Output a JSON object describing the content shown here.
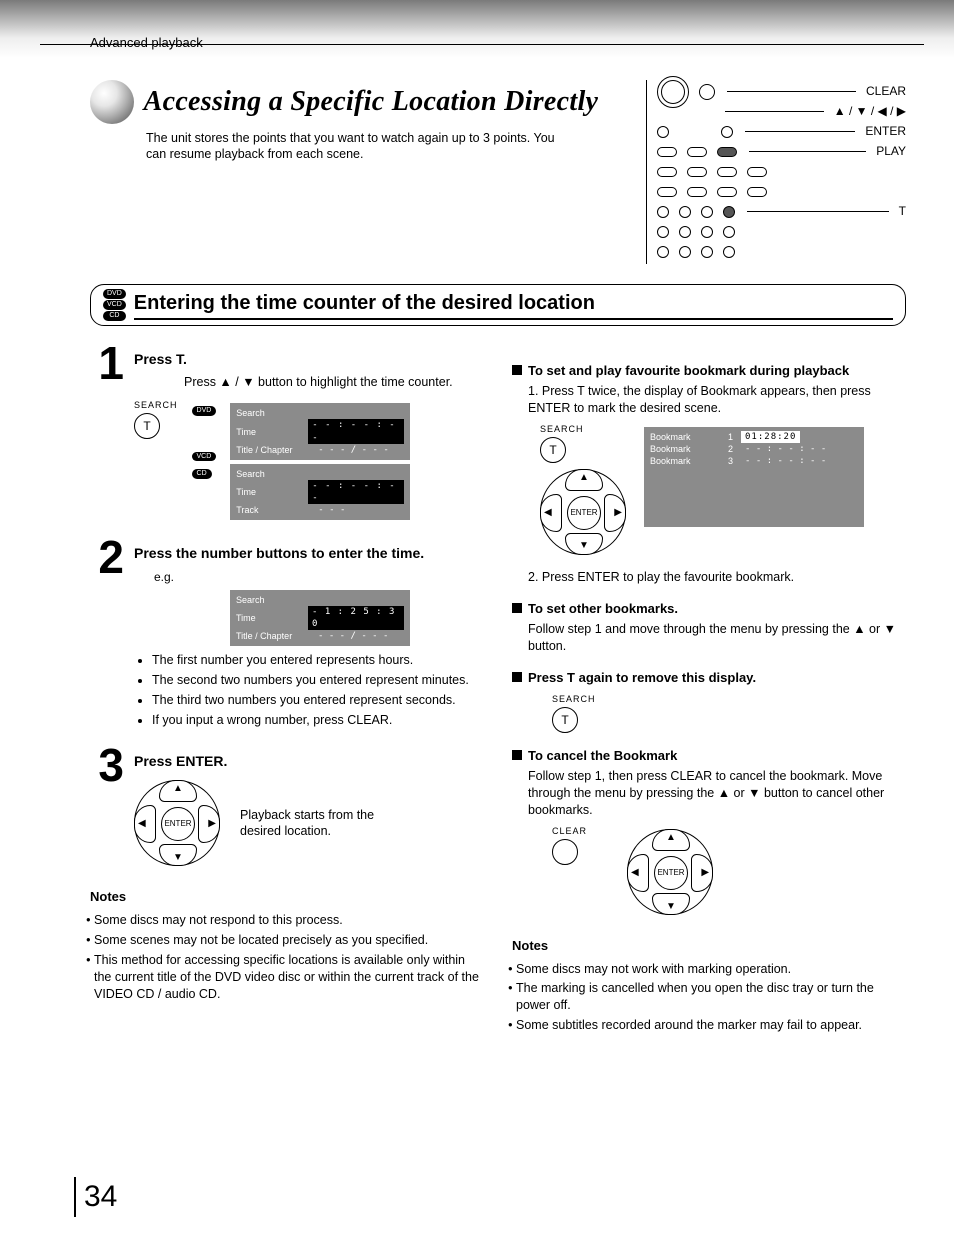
{
  "breadcrumb": "Advanced playback",
  "hero": {
    "title": "Accessing a Specific Location Directly",
    "sub": "The unit stores the points that you want to watch again up to 3 points. You can resume playback from each scene."
  },
  "remote_labels": {
    "clear": "CLEAR",
    "arrows": "▲ / ▼ / ◀ / ▶",
    "enter": "ENTER",
    "play": "PLAY",
    "t": "T"
  },
  "section": {
    "tags": [
      "DVD",
      "VCD",
      "CD"
    ],
    "title": "Entering the time counter of the desired location"
  },
  "left": {
    "step1": {
      "num": "1",
      "h": "Press T.",
      "p": "Press ▲ / ▼ button to highlight the time counter.",
      "search_label": "SEARCH",
      "t_label": "T",
      "dvd_tag": "DVD",
      "vcdcd_tags": [
        "VCD",
        "CD"
      ],
      "osd1": {
        "r1l": "Search",
        "r1v": "",
        "r2l": "Time",
        "r2v": "- - : - - : - -",
        "r3l": "Title / Chapter",
        "r3v": "- - - / - - -"
      },
      "osd2": {
        "r1l": "Search",
        "r1v": "",
        "r2l": "Time",
        "r2v": "- - : - - : - -",
        "r3l": "Track",
        "r3v": "- - -"
      }
    },
    "step2": {
      "num": "2",
      "h": "Press the number buttons to enter the time.",
      "eg": "e.g.",
      "osd": {
        "r1l": "Search",
        "r1v": "",
        "r2l": "Time",
        "r2v": "- 1 : 2 5 : 3 0",
        "r3l": "Title / Chapter",
        "r3v": "- - - / - - -"
      },
      "bullets": [
        "The first number you entered represents hours.",
        "The second two numbers you entered represent minutes.",
        "The third two numbers you entered represent seconds.",
        "If you input a wrong number, press CLEAR."
      ]
    },
    "step3": {
      "num": "3",
      "h": "Press ENTER.",
      "p": "Playback starts from the desired location.",
      "enter": "ENTER"
    },
    "notes_h": "Notes",
    "notes": [
      "Some discs may not respond to this process.",
      "Some scenes may not be located precisely as you specified.",
      "This method for accessing specific locations is available only within the current title of the DVD video disc or within the current track of the VIDEO CD / audio CD."
    ]
  },
  "right": {
    "b1": {
      "h": "To set and play favourite bookmark during playback",
      "p1": "1. Press T twice, the display of Bookmark appears, then press ENTER to mark the desired scene.",
      "search_label": "SEARCH",
      "t_label": "T",
      "enter": "ENTER",
      "osd": {
        "rows": [
          {
            "l": "Bookmark",
            "n": "1",
            "v": "01:28:20",
            "hl": true
          },
          {
            "l": "Bookmark",
            "n": "2",
            "v": "- - : - - : - -",
            "hl": false
          },
          {
            "l": "Bookmark",
            "n": "3",
            "v": "- - : - - : - -",
            "hl": false
          }
        ]
      },
      "p2": "2. Press ENTER to play the favourite bookmark."
    },
    "b2": {
      "h": "To set other bookmarks.",
      "p": "Follow step 1 and move through the menu by pressing the ▲ or ▼ button."
    },
    "b3": {
      "h": "Press T again to remove this display.",
      "search_label": "SEARCH",
      "t_label": "T"
    },
    "b4": {
      "h": "To cancel the Bookmark",
      "p": "Follow step 1, then press CLEAR to cancel the bookmark. Move through the menu by pressing the ▲ or ▼ button to cancel other bookmarks.",
      "clear_label": "CLEAR",
      "enter": "ENTER"
    },
    "notes_h": "Notes",
    "notes": [
      "Some discs may not work with marking operation.",
      "The marking is cancelled when you open the disc tray or turn the power off.",
      "Some subtitles recorded around the marker may fail to appear."
    ]
  },
  "page_number": "34"
}
